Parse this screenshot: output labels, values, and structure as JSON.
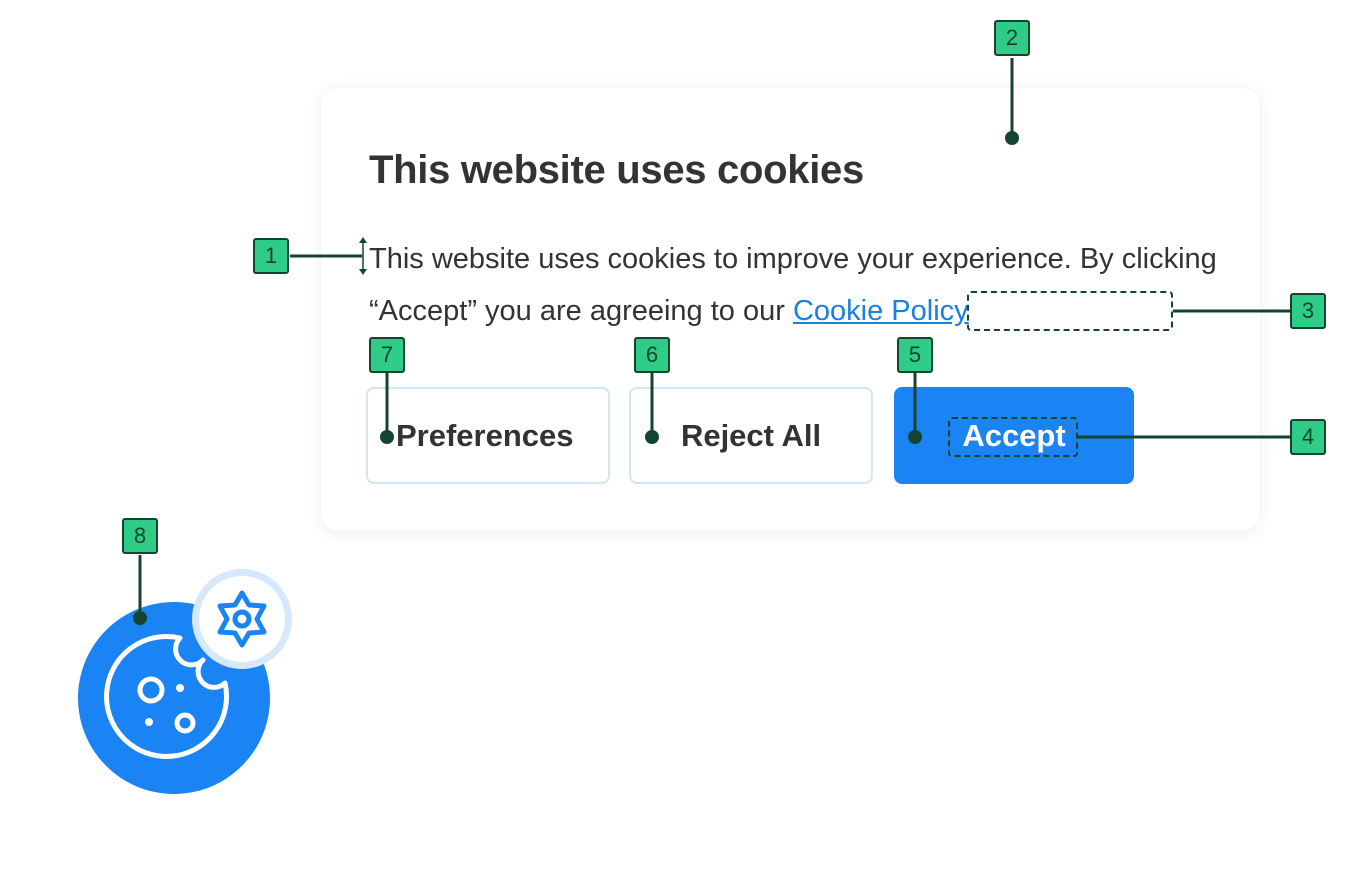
{
  "banner": {
    "title": "This website uses cookies",
    "text_before_link": "This website uses cookies to improve your experience. By clicking “Accept” you are agreeing to our ",
    "policy_link": "Cookie Policy",
    "buttons": {
      "preferences": "Preferences",
      "reject_all": "Reject All",
      "accept": "Accept"
    }
  },
  "widget": {
    "main_icon": "cookie-icon",
    "badge_icon": "gear-icon"
  },
  "annotations": [
    "1",
    "2",
    "3",
    "4",
    "5",
    "6",
    "7",
    "8"
  ],
  "colors": {
    "accent": "#1a84f5",
    "text": "#333333",
    "link": "#1a7fe6",
    "button_border": "#d3e5f7",
    "annotation_fill": "#2ecc87",
    "annotation_stroke": "#14432f"
  }
}
